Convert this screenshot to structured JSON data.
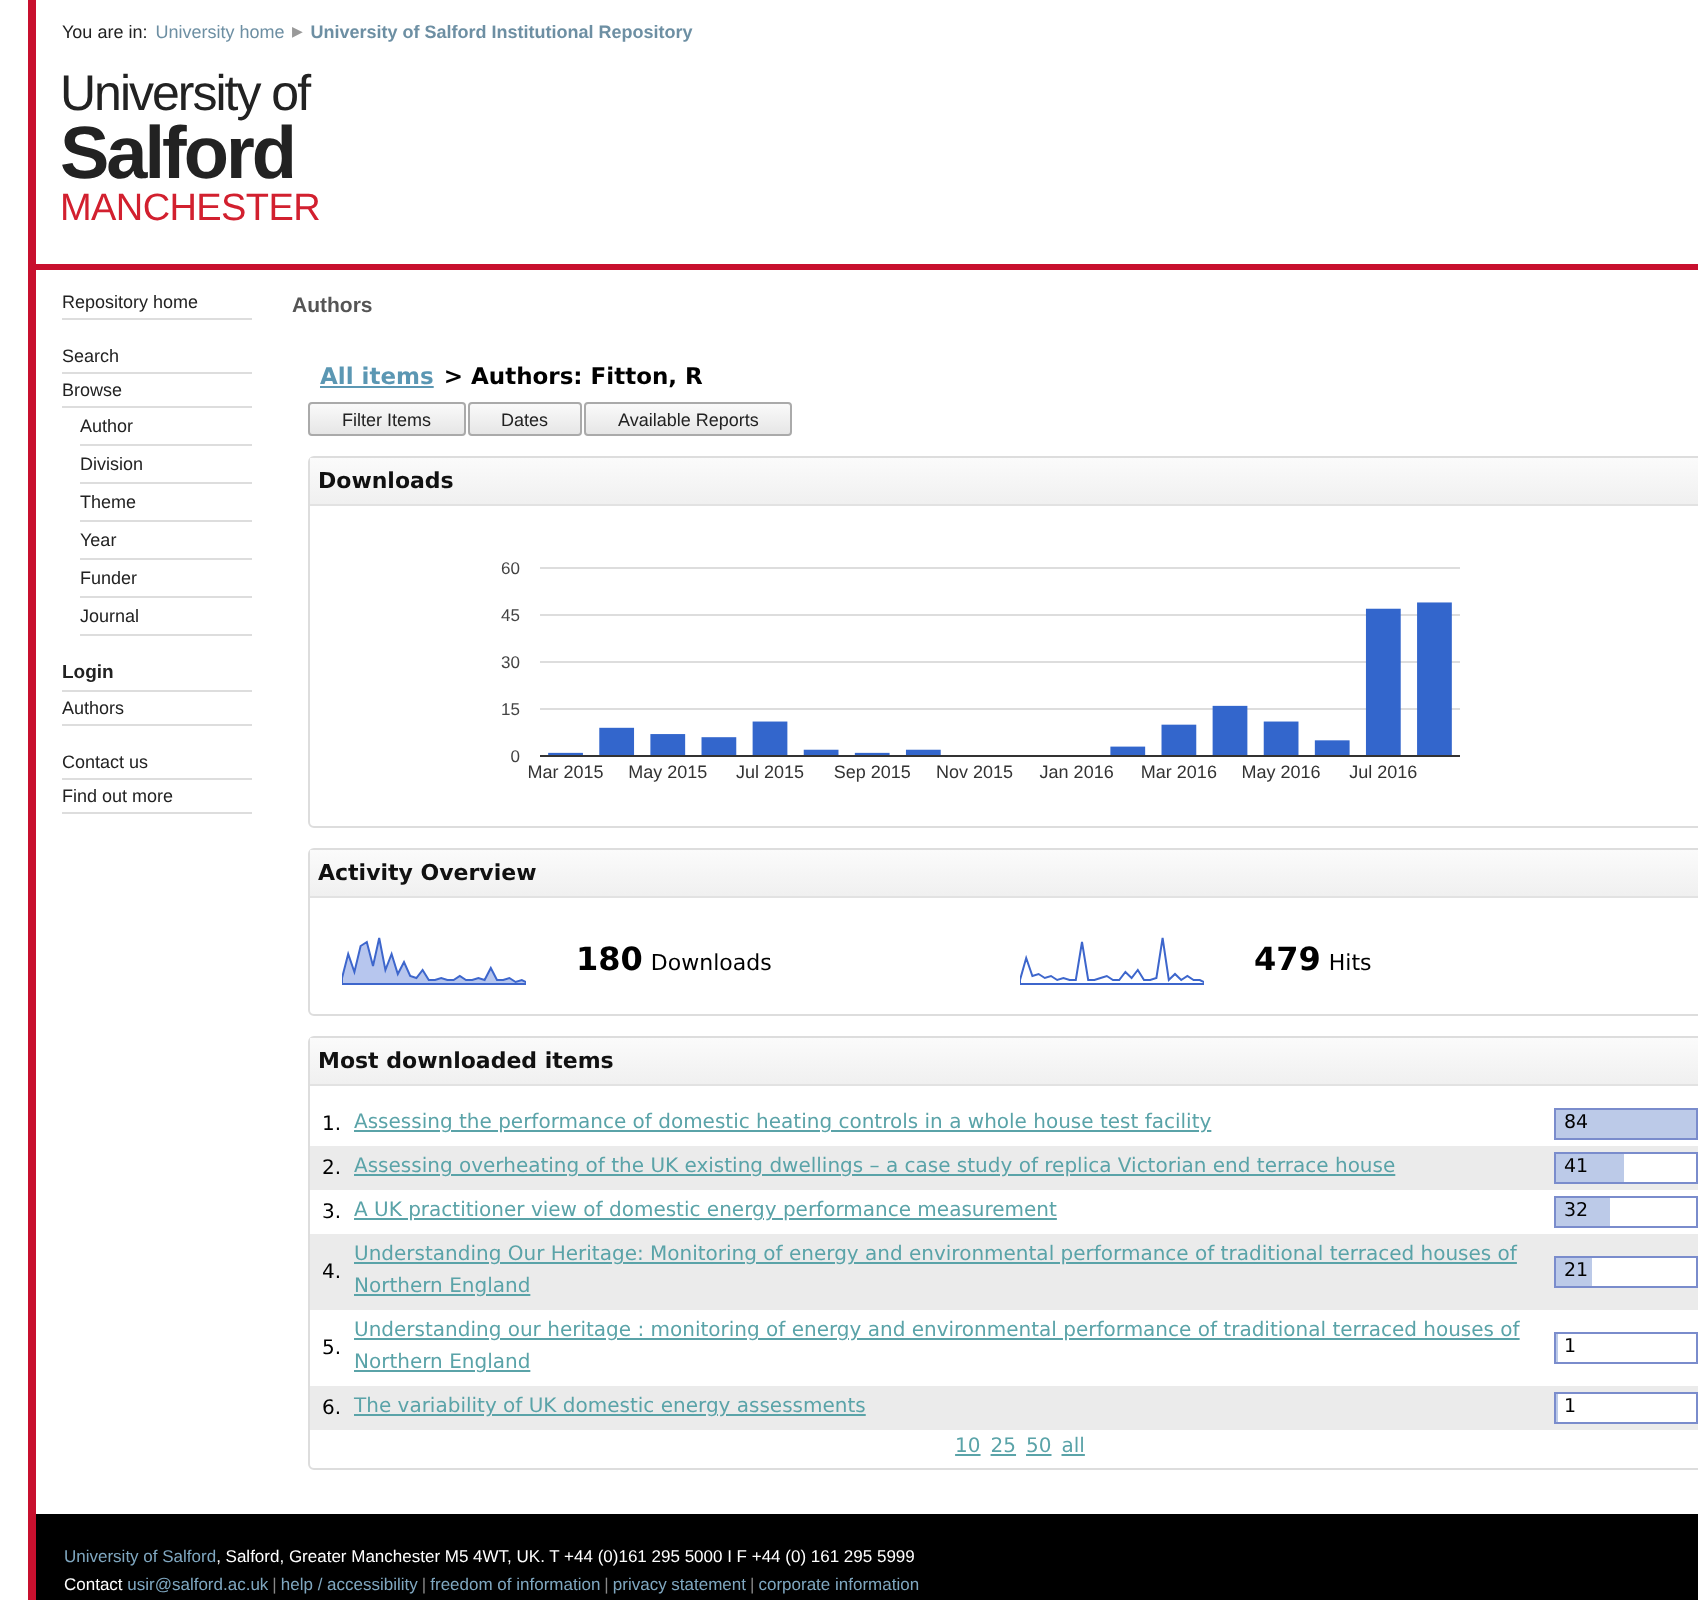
{
  "breadcrumb": {
    "prefix": "You are in:",
    "separator": "▶",
    "items": [
      "University home",
      "University of Salford Institutional Repository"
    ]
  },
  "logo": {
    "line1": "University of",
    "line2": "Salford",
    "line3": "MANCHESTER"
  },
  "sidebar": {
    "sections": [
      [
        {
          "kind": "link",
          "label": "Repository home"
        }
      ],
      [
        {
          "kind": "link",
          "label": "Search"
        },
        {
          "kind": "link",
          "label": "Browse",
          "children": [
            {
              "kind": "link",
              "label": "Author"
            },
            {
              "kind": "link",
              "label": "Division"
            },
            {
              "kind": "link",
              "label": "Theme"
            },
            {
              "kind": "link",
              "label": "Year"
            },
            {
              "kind": "link",
              "label": "Funder"
            },
            {
              "kind": "link",
              "label": "Journal"
            }
          ]
        }
      ],
      [
        {
          "kind": "heading",
          "label": "Login"
        },
        {
          "kind": "link",
          "label": "Authors"
        }
      ],
      [
        {
          "kind": "link",
          "label": "Contact us"
        },
        {
          "kind": "link",
          "label": "Find out more"
        }
      ]
    ]
  },
  "page_title": "Authors",
  "trail": {
    "link": "All items",
    "text": "> Authors: Fitton, R"
  },
  "buttons": [
    "Filter Items",
    "Dates",
    "Available Reports"
  ],
  "downloads": {
    "title": "Downloads",
    "chart_data": {
      "type": "bar",
      "categories": [
        "Mar 2015",
        null,
        "May 2015",
        null,
        "Jul 2015",
        null,
        "Sep 2015",
        null,
        "Nov 2015",
        null,
        "Jan 2016",
        null,
        "Mar 2016",
        null,
        "May 2016",
        null,
        "Jul 2016",
        null
      ],
      "grid": true,
      "series": [
        {
          "color": "#3366cc",
          "values": [
            1,
            9,
            7,
            6,
            11,
            2,
            1,
            2,
            0,
            0,
            0,
            3,
            10,
            16,
            11,
            5,
            47,
            49
          ]
        }
      ],
      "ylim": [
        0,
        60
      ],
      "yticks": [
        0,
        15,
        30,
        45,
        60
      ]
    }
  },
  "activity": {
    "title": "Activity Overview",
    "stats": [
      {
        "value": "180",
        "label": "Downloads"
      },
      {
        "value": "479",
        "label": "Hits"
      }
    ]
  },
  "most_downloaded": {
    "title": "Most downloaded items",
    "items": [
      {
        "rank": "1.",
        "title": "Assessing the performance of domestic heating controls in a whole house test facility",
        "count": "84",
        "level": 1
      },
      {
        "rank": "2.",
        "title": "Assessing overheating of the UK existing dwellings – a case study of replica Victorian end terrace house",
        "count": "41",
        "level": 0.49
      },
      {
        "rank": "3.",
        "title": "A UK practitioner view of domestic energy performance measurement",
        "count": "32",
        "level": 0.38
      },
      {
        "rank": "4.",
        "title": "Understanding Our Heritage: Monitoring of energy and environmental performance of traditional terraced houses of Northern England",
        "count": "21",
        "level": 0.25
      },
      {
        "rank": "5.",
        "title": "Understanding our heritage : monitoring of energy and environmental performance of traditional terraced houses of Northern England",
        "count": "1",
        "level": 0.012
      },
      {
        "rank": "6.",
        "title": "The variability of UK domestic energy assessments",
        "count": "1",
        "level": 0.012
      }
    ],
    "page_sizes": [
      "10",
      "25",
      "50",
      "all"
    ]
  },
  "footer": {
    "link": "University of Salford",
    "address": ", Salford, Greater Manchester M5 4WT, UK. T +44 (0)161 295 5000 I F +44 (0) 161 295 5999",
    "contact_label": "Contact",
    "separator": "|",
    "links": [
      "usir@salford.ac.uk",
      "help / accessibility",
      "freedom of information",
      "privacy statement",
      "corporate information"
    ]
  }
}
